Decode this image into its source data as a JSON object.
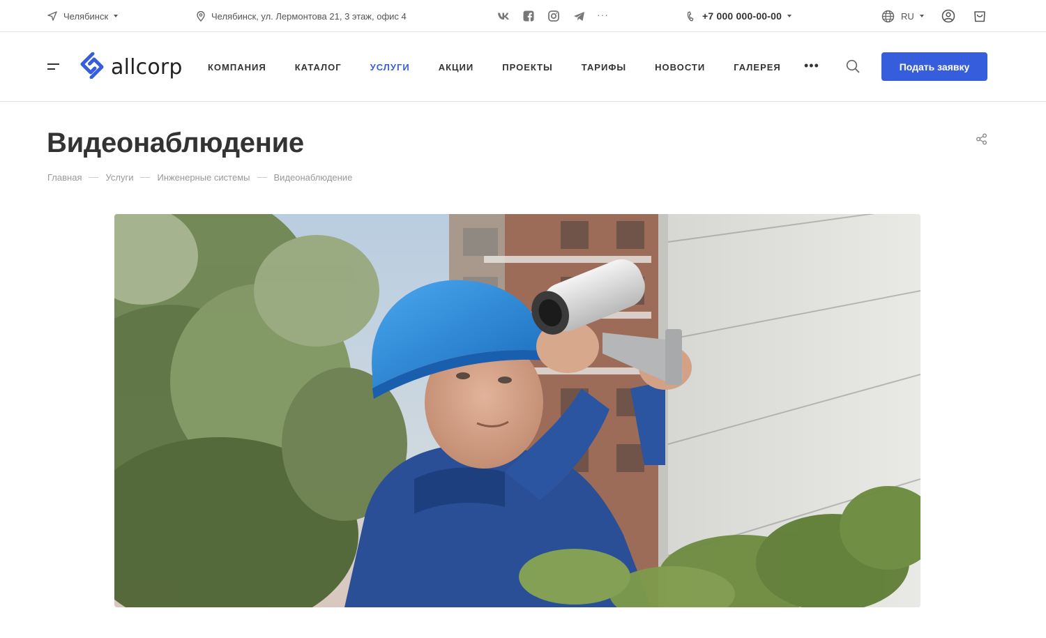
{
  "topbar": {
    "city": "Челябинск",
    "address": "Челябинск, ул. Лермонтова 21, 3 этаж, офис 4",
    "socials": [
      "vk-icon",
      "facebook-icon",
      "instagram-icon",
      "telegram-icon"
    ],
    "socials_more": "···",
    "phone": "+7 000 000-00-00",
    "language": "RU"
  },
  "header": {
    "logo_text": "allcorp",
    "nav": [
      {
        "label": "Компания",
        "active": false
      },
      {
        "label": "Каталог",
        "active": false
      },
      {
        "label": "Услуги",
        "active": true
      },
      {
        "label": "Акции",
        "active": false
      },
      {
        "label": "Проекты",
        "active": false
      },
      {
        "label": "Тарифы",
        "active": false
      },
      {
        "label": "Новости",
        "active": false
      },
      {
        "label": "Галерея",
        "active": false
      }
    ],
    "nav_more": "•••",
    "cta_label": "Подать заявку"
  },
  "page": {
    "title": "Видеонаблюдение",
    "breadcrumbs": [
      "Главная",
      "Услуги",
      "Инженерные системы",
      "Видеонаблюдение"
    ]
  },
  "colors": {
    "accent": "#365edc",
    "text": "#333333",
    "muted": "#999999"
  }
}
